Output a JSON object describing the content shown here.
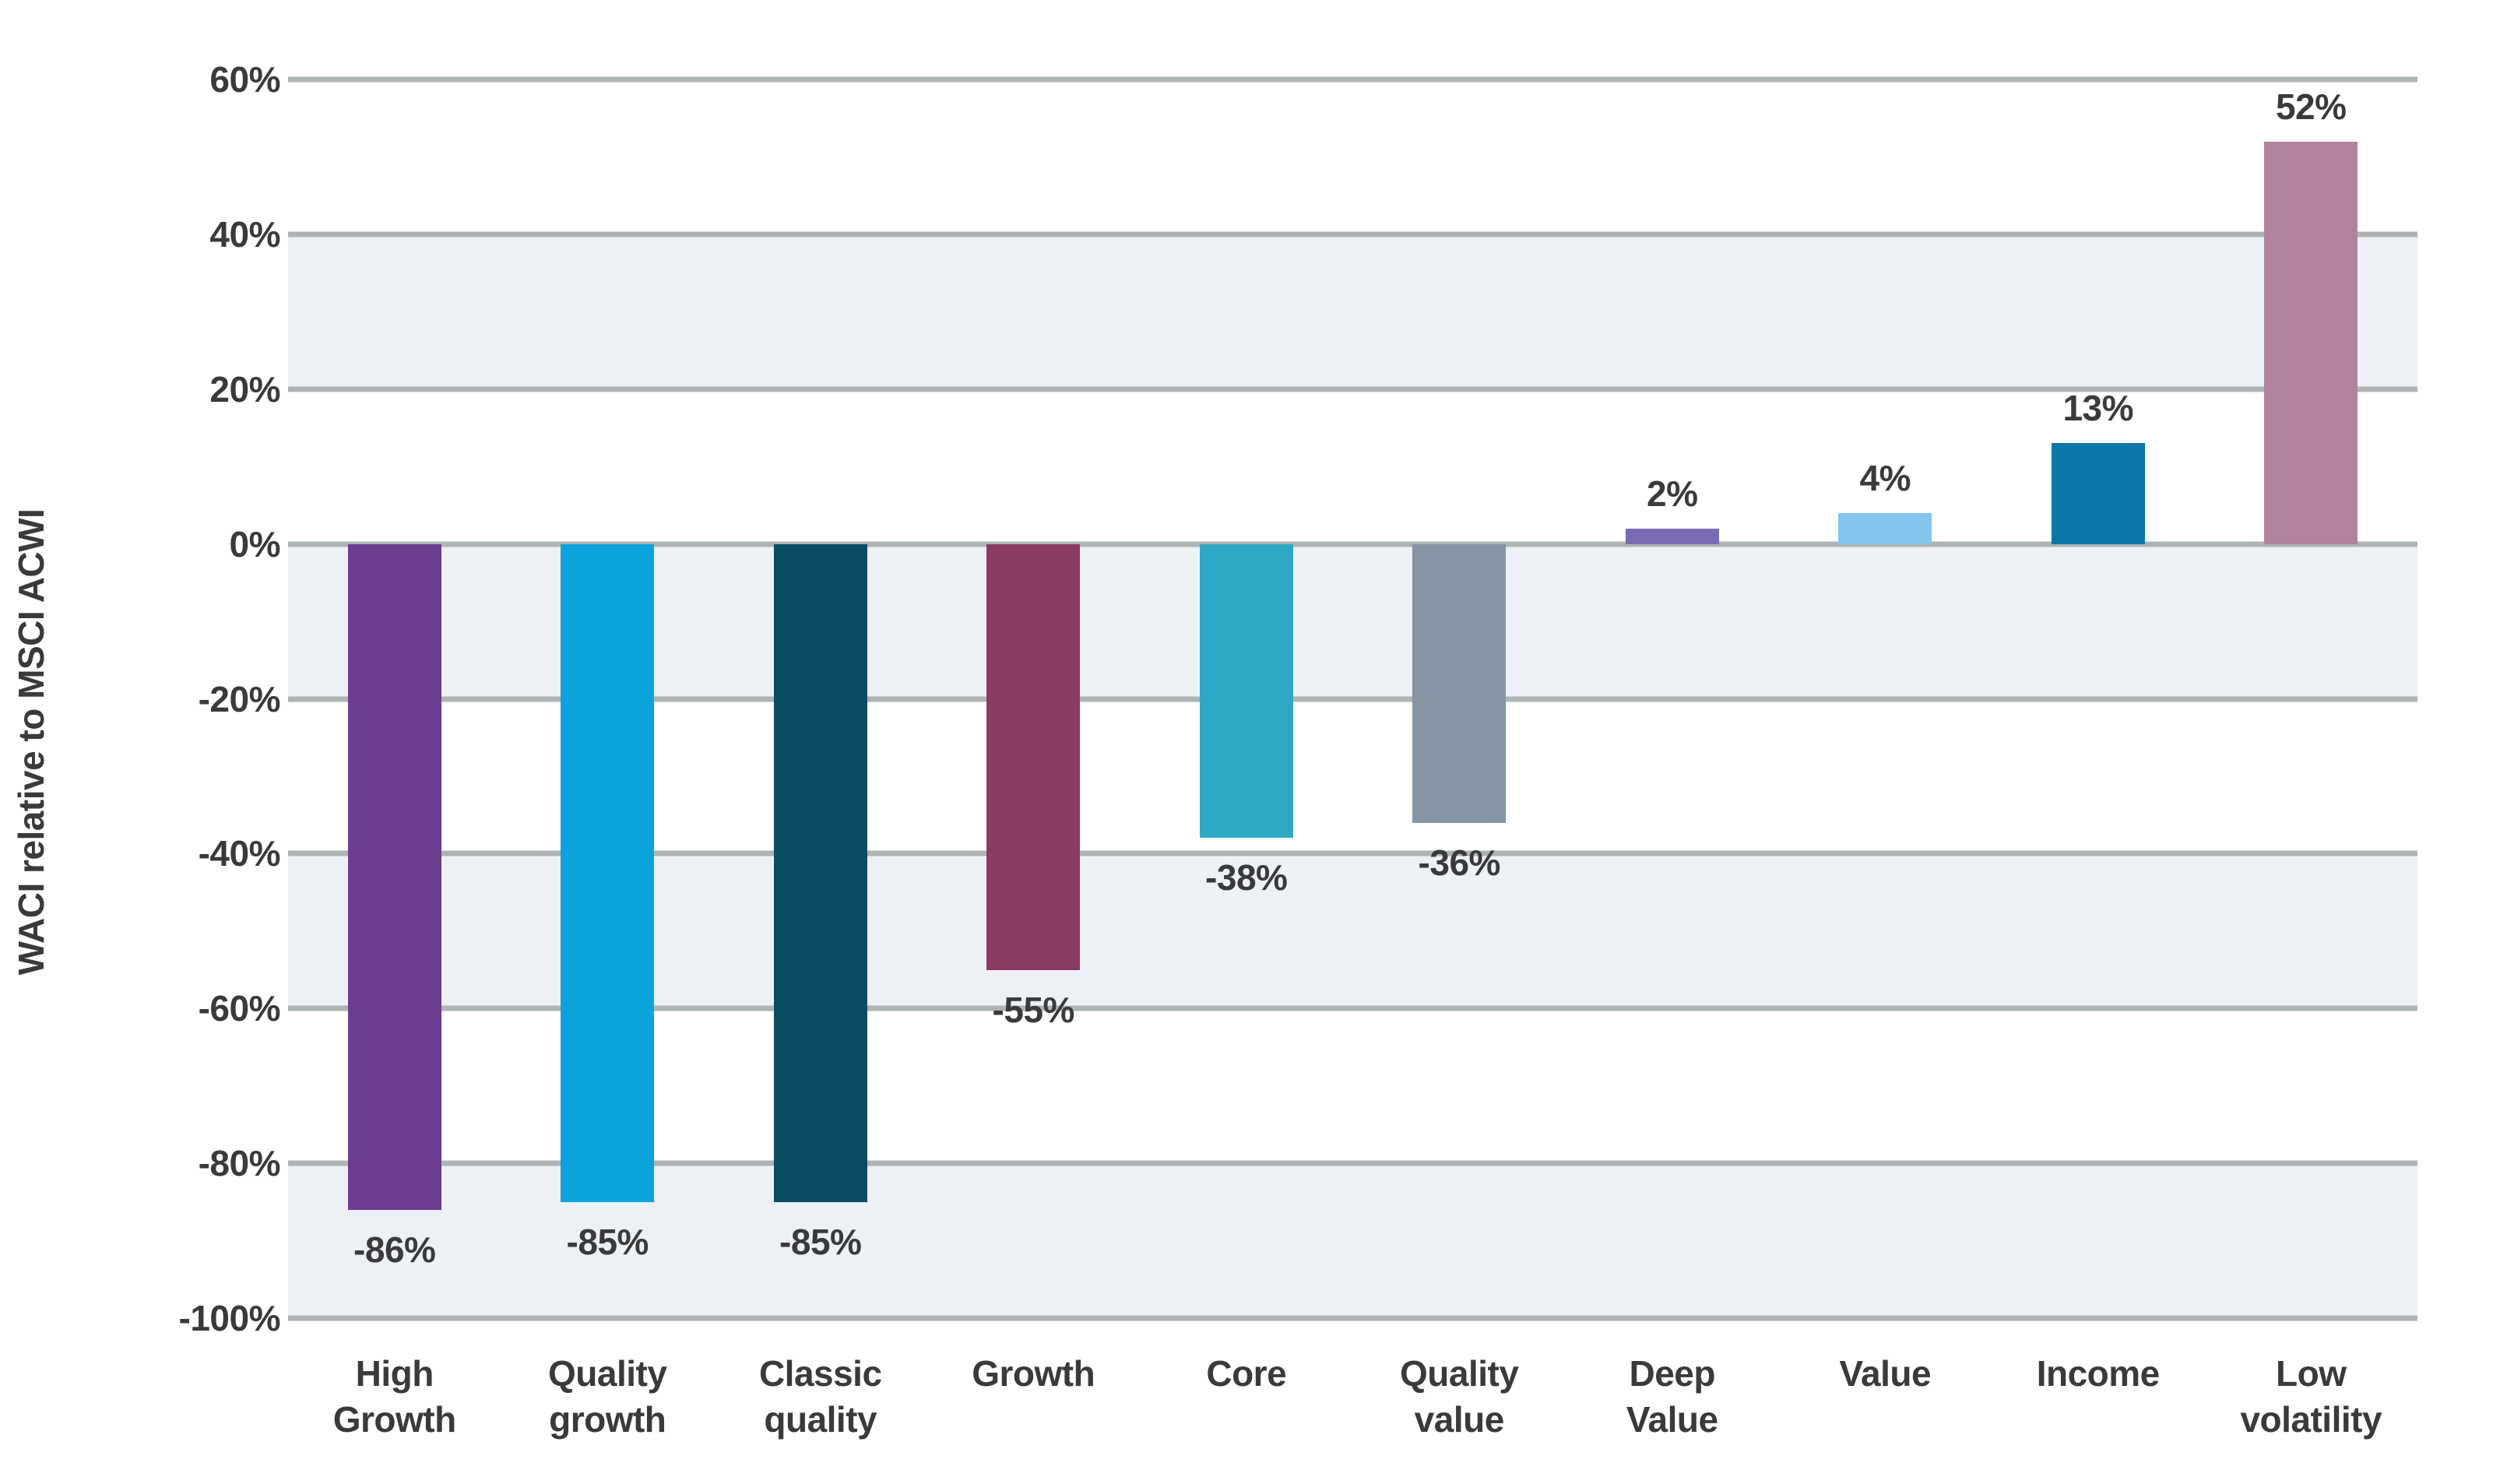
{
  "chart_data": {
    "type": "bar",
    "title": "",
    "subtitle": "",
    "xlabel": "",
    "ylabel": "WACI relative to MSCI ACWI",
    "ylim": [
      -100,
      60
    ],
    "ytick_step": 20,
    "ytick_labels": [
      "60%",
      "40%",
      "20%",
      "0%",
      "-20%",
      "-40%",
      "-60%",
      "-80%",
      "-100%"
    ],
    "ytick_values": [
      60,
      40,
      20,
      0,
      -20,
      -40,
      -60,
      -80,
      -100
    ],
    "grid": true,
    "grid_color": "#aeb4b4",
    "band_color": "#edf1f5",
    "legend": false,
    "legend_position": "none",
    "value_labels_shown": true,
    "categories": [
      "High Growth",
      "Quality growth",
      "Classic quality",
      "Growth",
      "Core",
      "Quality value",
      "Deep Value",
      "Value",
      "Income",
      "Low volatility"
    ],
    "category_lines": [
      [
        "High",
        "Growth"
      ],
      [
        "Quality",
        "growth"
      ],
      [
        "Classic",
        "quality"
      ],
      [
        "Growth"
      ],
      [
        "Core"
      ],
      [
        "Quality",
        "value"
      ],
      [
        "Deep",
        "Value"
      ],
      [
        "Value"
      ],
      [
        "Income"
      ],
      [
        "Low",
        "volatility"
      ]
    ],
    "values": [
      -86,
      -85,
      -85,
      -55,
      -38,
      -36,
      2,
      4,
      13,
      52
    ],
    "value_labels": [
      "-86%",
      "-85%",
      "-85%",
      "-55%",
      "-38%",
      "-36%",
      "2%",
      "4%",
      "13%",
      "52%"
    ],
    "colors": [
      "#6b3d8f",
      "#0ba3dc",
      "#0a4d63",
      "#8b3a63",
      "#2ea8c4",
      "#8595a3",
      "#7a6bb5",
      "#83c5ef",
      "#0b76a8",
      "#b0829b"
    ],
    "series": [
      {
        "name": "WACI relative to MSCI ACWI",
        "values": [
          -86,
          -85,
          -85,
          -55,
          -38,
          -36,
          2,
          4,
          13,
          52
        ]
      }
    ]
  }
}
